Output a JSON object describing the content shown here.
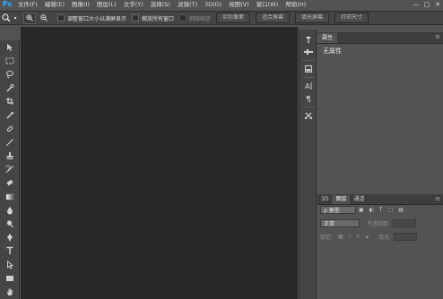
{
  "app": {
    "logo": "Ps"
  },
  "menu": [
    "文件(F)",
    "编辑(E)",
    "图像(I)",
    "图层(L)",
    "文字(Y)",
    "选择(S)",
    "滤镜(T)",
    "3D(D)",
    "视图(V)",
    "窗口(W)",
    "帮助(H)"
  ],
  "window_controls": {
    "minimize": "—",
    "restore": "□",
    "close": "✕"
  },
  "options": {
    "resize_windows_label": "调整窗口大小以满屏显示",
    "zoom_all_label": "缩放所有窗口",
    "scrubby_zoom_label": "细微缩放",
    "actual_pixels": "实际像素",
    "fit_screen": "适合屏幕",
    "fill_screen": "填充屏幕",
    "print_size": "打印尺寸"
  },
  "properties_panel": {
    "tab": "属性",
    "body_text": "无属性"
  },
  "layers_panel": {
    "tabs": [
      "3D",
      "图层",
      "通道"
    ],
    "filter_kind": "ρ 类型",
    "blend_mode": "正常",
    "opacity_label": "不透明度:",
    "lock_label": "锁定:",
    "fill_label": "填充:"
  }
}
